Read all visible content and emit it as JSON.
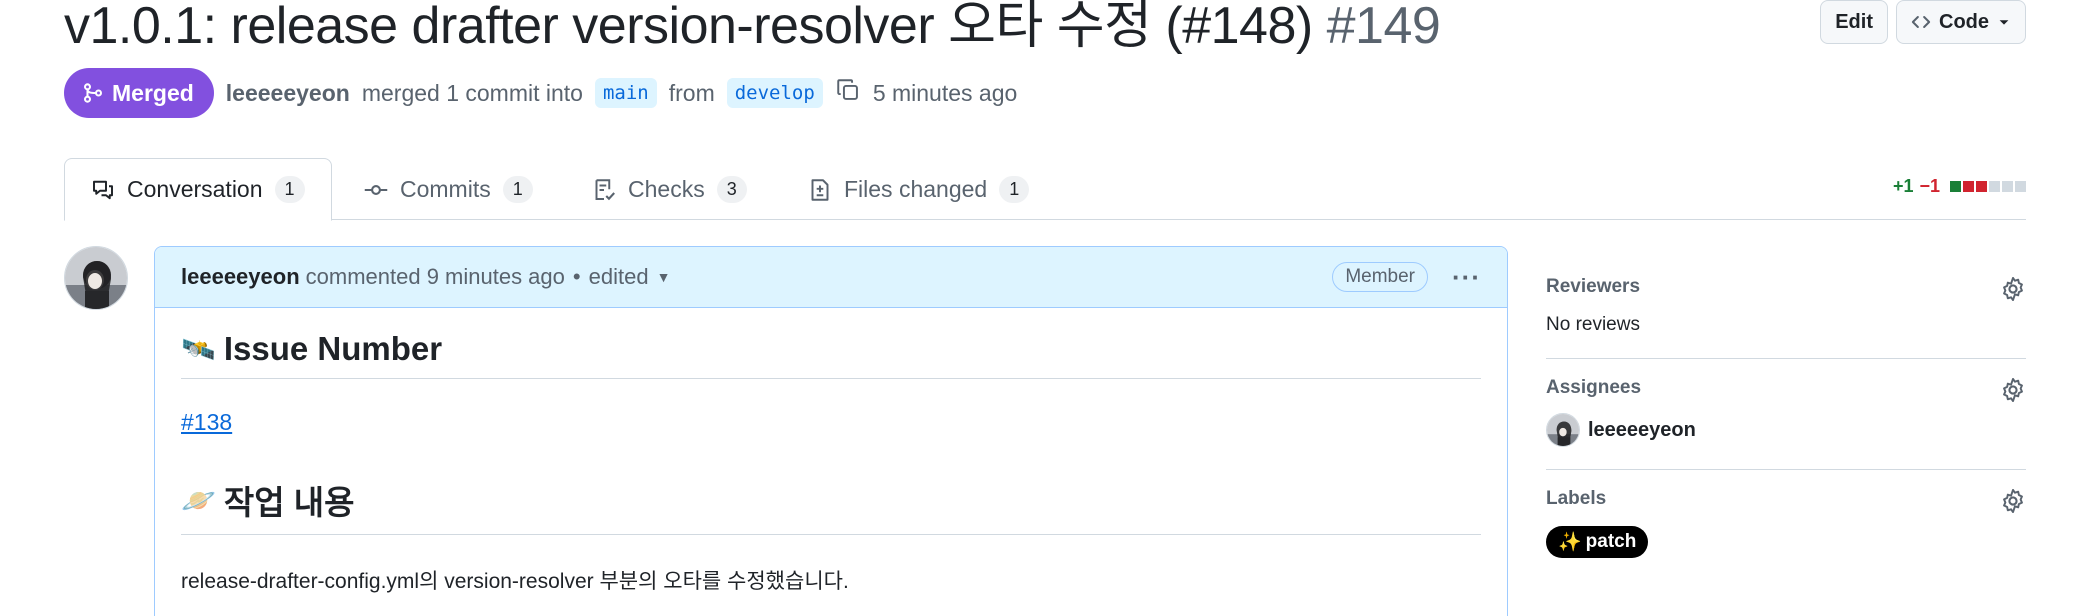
{
  "pr": {
    "title": "v1.0.1: release drafter version-resolver 오타 수정 (#148)",
    "number": "#149",
    "state": "Merged",
    "author": "leeeeeyeon",
    "merged_text": "merged 1 commit into",
    "base_branch": "main",
    "from_text": "from",
    "head_branch": "develop",
    "time": "5 minutes ago"
  },
  "actions": {
    "edit_label": "Edit",
    "code_label": "Code"
  },
  "tabs": [
    {
      "label": "Conversation",
      "count": "1",
      "icon": "comment-discussion-icon"
    },
    {
      "label": "Commits",
      "count": "1",
      "icon": "git-commit-icon"
    },
    {
      "label": "Checks",
      "count": "3",
      "icon": "checklist-icon"
    },
    {
      "label": "Files changed",
      "count": "1",
      "icon": "file-diff-icon"
    }
  ],
  "diffstat": {
    "additions": "+1",
    "deletions": "−1",
    "colors": [
      "#1a7f37",
      "#d1242f",
      "#d1242f",
      "#d1d9e0",
      "#d1d9e0",
      "#d1d9e0"
    ]
  },
  "comment": {
    "author": "leeeeeyeon",
    "action": "commented 9 minutes ago",
    "separator": "•",
    "edited": "edited",
    "role": "Member",
    "heading1_emoji": "🛰️",
    "heading1": "Issue Number",
    "issue_link": "#138",
    "heading2_emoji": "🪐",
    "heading2": "작업 내용",
    "paragraph": "release-drafter-config.yml의 version-resolver 부분의 오타를 수정했습니다."
  },
  "sidebar": {
    "reviewers_title": "Reviewers",
    "reviewers_value": "No reviews",
    "assignees_title": "Assignees",
    "assignee_name": "leeeeeyeon",
    "labels_title": "Labels",
    "label_emoji": "✨",
    "label_name": "patch"
  },
  "colors": {
    "merged": "#8250df",
    "link": "#0969da",
    "comment_header": "#ddf4ff"
  }
}
